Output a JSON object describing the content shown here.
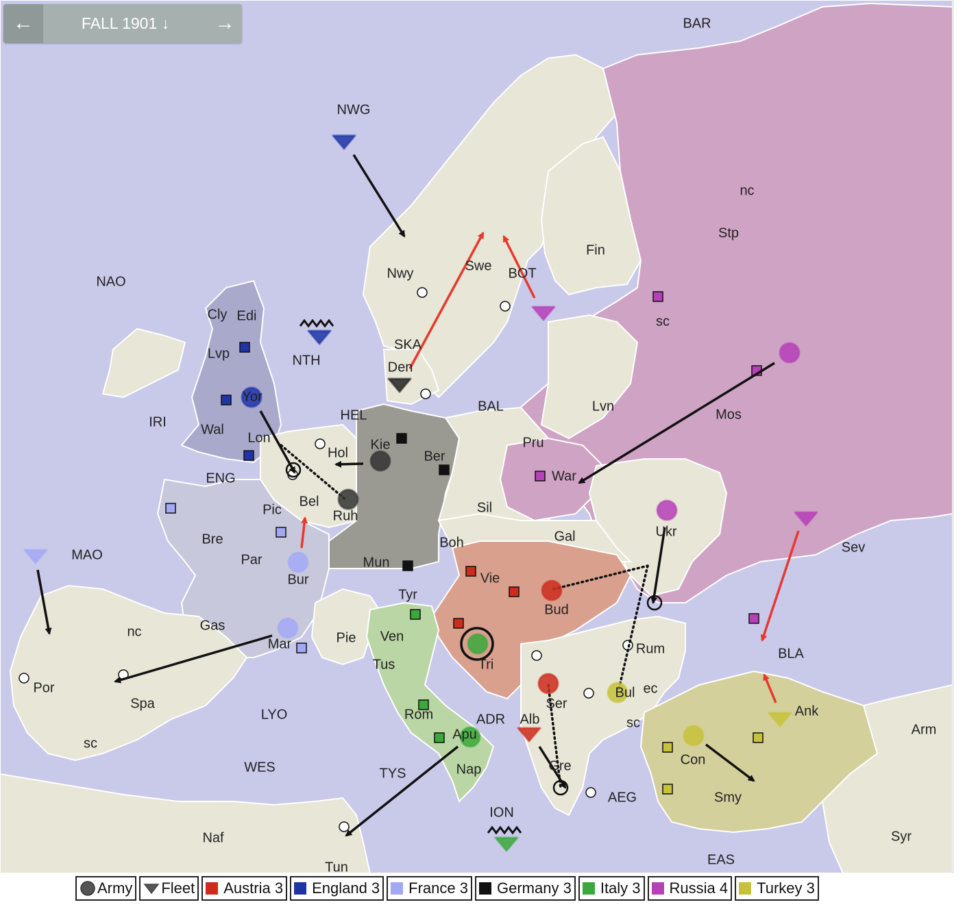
{
  "nav": {
    "prev_icon": "arrow-left-icon",
    "prev_glyph": "←",
    "season_label": "FALL 1901 ↓",
    "next_icon": "arrow-right-icon",
    "next_glyph": "→"
  },
  "colors": {
    "sea": "#c9c9ea",
    "land": "#e7e6d7",
    "border": "#ffffff",
    "austria": "#d9a08e",
    "england": "#a9a9cc",
    "france": "#c8c8dc",
    "germany": "#9b9a92",
    "italy": "#b9d6a4",
    "russia": "#cfa3c4",
    "turkey": "#d3d09c"
  },
  "legend": [
    {
      "key": "army",
      "icon": "army-icon",
      "label": "Army",
      "color": "#555555"
    },
    {
      "key": "fleet",
      "icon": "fleet-icon",
      "label": "Fleet",
      "color": "#555555"
    },
    {
      "key": "austria",
      "label": "Austria 3",
      "color": "#cc2b1d"
    },
    {
      "key": "england",
      "label": "England 3",
      "color": "#1f35a6"
    },
    {
      "key": "france",
      "label": "France 3",
      "color": "#a3a8f5"
    },
    {
      "key": "germany",
      "label": "Germany 3",
      "color": "#111111"
    },
    {
      "key": "italy",
      "label": "Italy 3",
      "color": "#3aa83a"
    },
    {
      "key": "russia",
      "label": "Russia 4",
      "color": "#b540b8"
    },
    {
      "key": "turkey",
      "label": "Turkey 3",
      "color": "#c6c23a"
    }
  ],
  "provinces": [
    "BAR",
    "NWG",
    "NAO",
    "nc",
    "Stp",
    "Fin",
    "Nwy",
    "Swe",
    "BOT",
    "sc",
    "Cly",
    "Edi",
    "NTH",
    "SKA",
    "Den",
    "Lvp",
    "Yor",
    "IRI",
    "HEL",
    "BAL",
    "Lvn",
    "Wal",
    "Lon",
    "Hol",
    "Kie",
    "Ber",
    "Mos",
    "Pru",
    "ENG",
    "Bel",
    "Ruh",
    "War",
    "Pic",
    "Sil",
    "Ukr",
    "Bre",
    "Mun",
    "Boh",
    "Gal",
    "Par",
    "Bur",
    "Sev",
    "MAO",
    "Vie",
    "Bud",
    "Tyr",
    "nc",
    "Gas",
    "Mar",
    "Pie",
    "Ven",
    "Tri",
    "Rum",
    "BLA",
    "Tus",
    "Por",
    "Spa",
    "Bul",
    "ec",
    "Ser",
    "Ank",
    "Rom",
    "LYO",
    "ADR",
    "Alb",
    "sc",
    "Apu",
    "Arm",
    "sc",
    "Con",
    "Gre",
    "WES",
    "TYS",
    "Nap",
    "AEG",
    "Smy",
    "ION",
    "Naf",
    "Syr",
    "EAS",
    "Tun"
  ]
}
